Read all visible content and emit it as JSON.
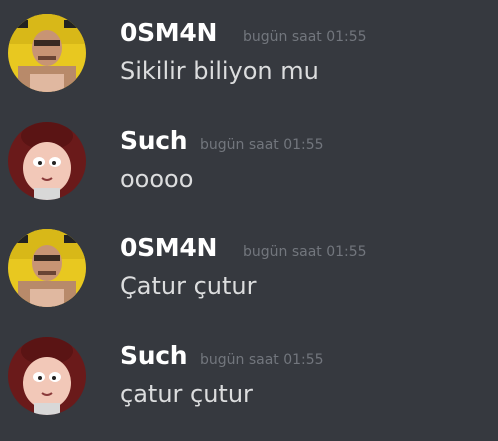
{
  "messages": [
    {
      "avatar": "osman-avatar",
      "author": "0SM4N",
      "author_color": "#ffffff",
      "timestamp": "bugün saat 01:55",
      "text": "Sikilir biliyon mu"
    },
    {
      "avatar": "such-avatar",
      "author": "Such",
      "author_color": "#ffffff",
      "timestamp": "bugün saat 01:55",
      "text": "ooooo"
    },
    {
      "avatar": "osman-avatar",
      "author": "0SM4N",
      "author_color": "#ffffff",
      "timestamp": "bugün saat 01:55",
      "text": "Çatur çutur"
    },
    {
      "avatar": "such-avatar",
      "author": "Such",
      "author_color": "#ffffff",
      "timestamp": "bugün saat 01:55",
      "text": "çatur çutur"
    }
  ],
  "colors": {
    "background": "#36393f",
    "timestamp": "#72767d",
    "message_text": "#dcddde"
  }
}
